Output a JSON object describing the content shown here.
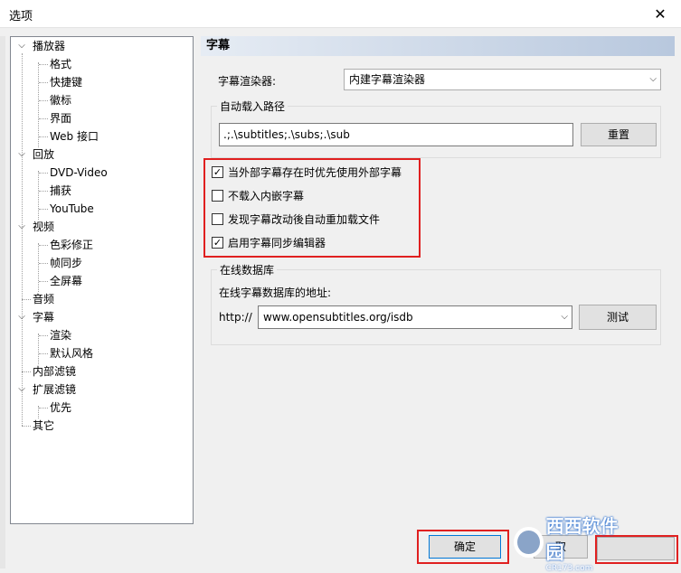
{
  "window": {
    "title": "选项"
  },
  "tree": [
    {
      "label": "播放器",
      "level": 0,
      "expanded": true
    },
    {
      "label": "格式",
      "level": 1
    },
    {
      "label": "快捷键",
      "level": 1
    },
    {
      "label": "徽标",
      "level": 1
    },
    {
      "label": "界面",
      "level": 1
    },
    {
      "label": "Web 接口",
      "level": 1
    },
    {
      "label": "回放",
      "level": 0,
      "expanded": true
    },
    {
      "label": "DVD-Video",
      "level": 1
    },
    {
      "label": "捕获",
      "level": 1
    },
    {
      "label": "YouTube",
      "level": 1
    },
    {
      "label": "视频",
      "level": 0,
      "expanded": true
    },
    {
      "label": "色彩修正",
      "level": 1
    },
    {
      "label": "帧同步",
      "level": 1
    },
    {
      "label": "全屏幕",
      "level": 1
    },
    {
      "label": "音频",
      "level": 0
    },
    {
      "label": "字幕",
      "level": 0,
      "expanded": true,
      "selected": true
    },
    {
      "label": "渲染",
      "level": 1
    },
    {
      "label": "默认风格",
      "level": 1
    },
    {
      "label": "内部滤镜",
      "level": 0
    },
    {
      "label": "扩展滤镜",
      "level": 0,
      "expanded": true
    },
    {
      "label": "优先",
      "level": 1
    },
    {
      "label": "其它",
      "level": 0
    }
  ],
  "panel": {
    "title": "字幕",
    "renderer_label": "字幕渲染器:",
    "renderer_value": "内建字幕渲染器",
    "autoload_group": "自动载入路径",
    "autoload_path": ".;.\\subtitles;.\\subs;.\\sub",
    "reset_button": "重置",
    "checkboxes": [
      {
        "label": "当外部字幕存在时优先使用外部字幕",
        "checked": true
      },
      {
        "label": "不载入内嵌字幕",
        "checked": false
      },
      {
        "label": "发现字幕改动後自动重加载文件",
        "checked": false
      },
      {
        "label": "启用字幕同步编辑器",
        "checked": true
      }
    ],
    "online_group": "在线数据库",
    "online_address_label": "在线字幕数据库的地址:",
    "http_prefix": "http://",
    "online_url": "www.opensubtitles.org/isdb",
    "test_button": "测试"
  },
  "footer": {
    "ok_button": "确定",
    "cancel_partial": "取"
  },
  "watermark": {
    "text": "西西软件园",
    "subtext": "CR173.com"
  },
  "colors": {
    "highlight_red": "#e02020",
    "header_gradient_end": "#b8c8de"
  }
}
